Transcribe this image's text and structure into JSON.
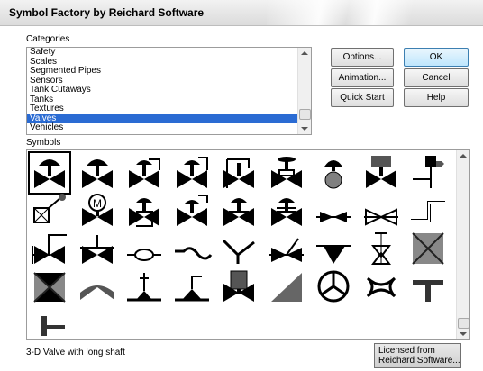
{
  "window": {
    "title": "Symbol Factory by Reichard Software"
  },
  "categories": {
    "label": "Categories",
    "items": [
      "Safety",
      "Scales",
      "Segmented Pipes",
      "Sensors",
      "Tank Cutaways",
      "Tanks",
      "Textures",
      "Valves",
      "Vehicles"
    ],
    "selected": "Valves"
  },
  "buttons": {
    "options": "Options...",
    "ok": "OK",
    "animation": "Animation...",
    "cancel": "Cancel",
    "quick_start": "Quick Start",
    "help": "Help"
  },
  "symbols": {
    "label": "Symbols",
    "selected_index": 0,
    "icons": [
      "valve-long-shaft-icon",
      "valve-diaphragm-icon",
      "valve-angled-pipe-icon",
      "valve-angled-pipe-2-icon",
      "valve-pipe-loop-icon",
      "valve-handwheel-icon",
      "valve-ball-actuator-icon",
      "valve-motor-block-icon",
      "valve-positioner-icon",
      "valve-angle-actuator-icon",
      "valve-motor-m-icon",
      "valve-globe-icon",
      "valve-positioner-2-icon",
      "valve-globe-2-icon",
      "valve-globe-3-icon",
      "valve-inline-icon",
      "valve-inline-2-icon",
      "pipe-bend-icon",
      "valve-pipe-l-icon",
      "valve-pipe-t-icon",
      "valve-butterfly-icon",
      "pipe-loop-icon",
      "pipe-elbow-icon",
      "valve-check-icon",
      "valve-3way-icon",
      "valve-needle-icon",
      "valve-square-icon",
      "valve-gate-square-icon",
      "valve-tent-icon",
      "valve-actuator-base-icon",
      "valve-actuator-base-2-icon",
      "valve-cylinder-icon",
      "valve-triangle-icon",
      "valve-wheel-icon",
      "valve-cross-icon",
      "valve-tee-icon",
      "valve-stub-icon"
    ]
  },
  "status": {
    "description": "3-D Valve with long shaft",
    "license_line1": "Licensed from",
    "license_line2": "Reichard Software..."
  },
  "colors": {
    "selection": "#2a6bd3",
    "icon_fill": "#000000",
    "icon_grey": "#808080"
  }
}
